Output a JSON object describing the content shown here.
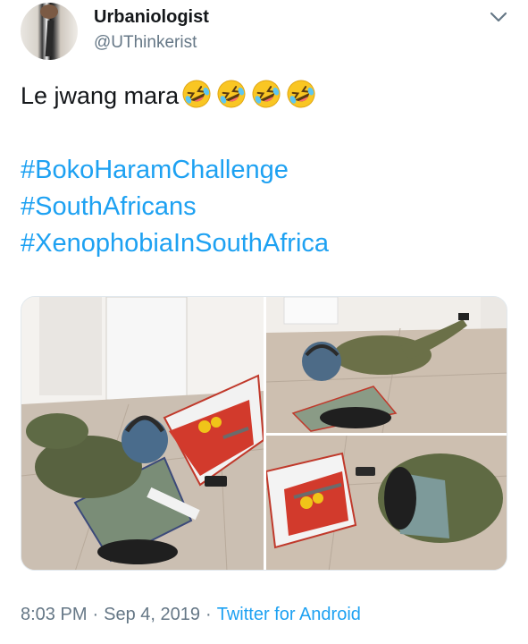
{
  "author": {
    "display_name": "Urbaniologist",
    "handle": "@UThinkerist"
  },
  "tweet": {
    "text": "Le jwang mara",
    "emoji": [
      "rolling-on-floor-laughing",
      "rolling-on-floor-laughing",
      "rolling-on-floor-laughing",
      "rolling-on-floor-laughing"
    ],
    "hashtags": [
      "#BokoHaramChallenge",
      "#SouthAfricans",
      "#XenophobiaInSouthAfrica"
    ]
  },
  "meta": {
    "time": "8:03 PM",
    "separator": "·",
    "date": "Sep 4, 2019",
    "client": "Twitter for Android"
  },
  "colors": {
    "link": "#1da1f2",
    "secondary_text": "#657786",
    "primary_text": "#14171a"
  },
  "icons": {
    "menu": "chevron-down-icon",
    "emoji": "rolling-on-floor-laughing-emoji-icon"
  }
}
